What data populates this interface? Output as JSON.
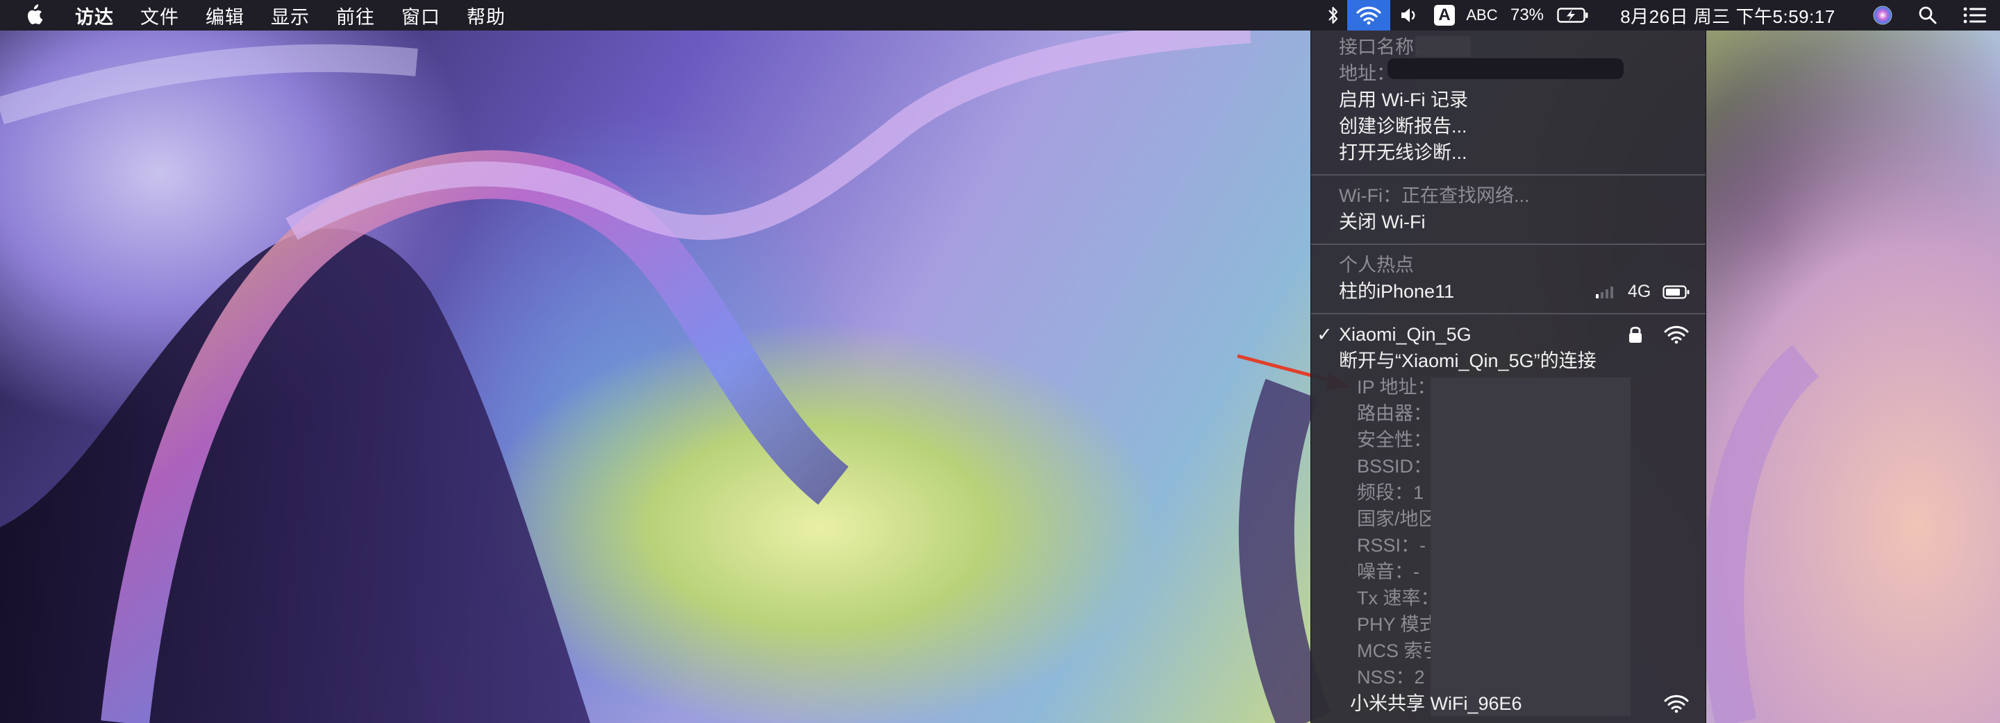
{
  "menubar": {
    "app_name": "访达",
    "menus": [
      "文件",
      "编辑",
      "显示",
      "前往",
      "窗口",
      "帮助"
    ],
    "input_source": "ABC",
    "input_badge": "A",
    "battery": "73%",
    "datetime": "8月26日 周三 下午5:59:17"
  },
  "wifi_menu": {
    "interface_label": "接口名称：",
    "address_label": "地址：",
    "enable_logging": "启用 Wi-Fi 记录",
    "create_report": "创建诊断报告...",
    "open_diagnostics": "打开无线诊断...",
    "wifi_status": "Wi-Fi：正在查找网络...",
    "turn_off": "关闭 Wi-Fi",
    "hotspot_header": "个人热点",
    "hotspot_name": "柱的iPhone11",
    "hotspot_network": "4G",
    "connected_check": "✓",
    "connected_name": "Xiaomi_Qin_5G",
    "disconnect": "断开与“Xiaomi_Qin_5G”的连接",
    "details": [
      {
        "label": "IP 地址："
      },
      {
        "label": "路由器："
      },
      {
        "label": "安全性："
      },
      {
        "label": "BSSID："
      },
      {
        "label": "频段：1"
      },
      {
        "label": "国家/地区"
      },
      {
        "label": "RSSI：-"
      },
      {
        "label": "噪音：-"
      },
      {
        "label": "Tx 速率："
      },
      {
        "label": "PHY 模式"
      },
      {
        "label": "MCS 索引"
      },
      {
        "label": "NSS：2"
      }
    ],
    "other_network": "小米共享 WiFi_96E6"
  },
  "colors": {
    "menubar_bg": "#1f1d26",
    "wifi_active": "#2f6fe0",
    "arrow": "#e0402a"
  }
}
